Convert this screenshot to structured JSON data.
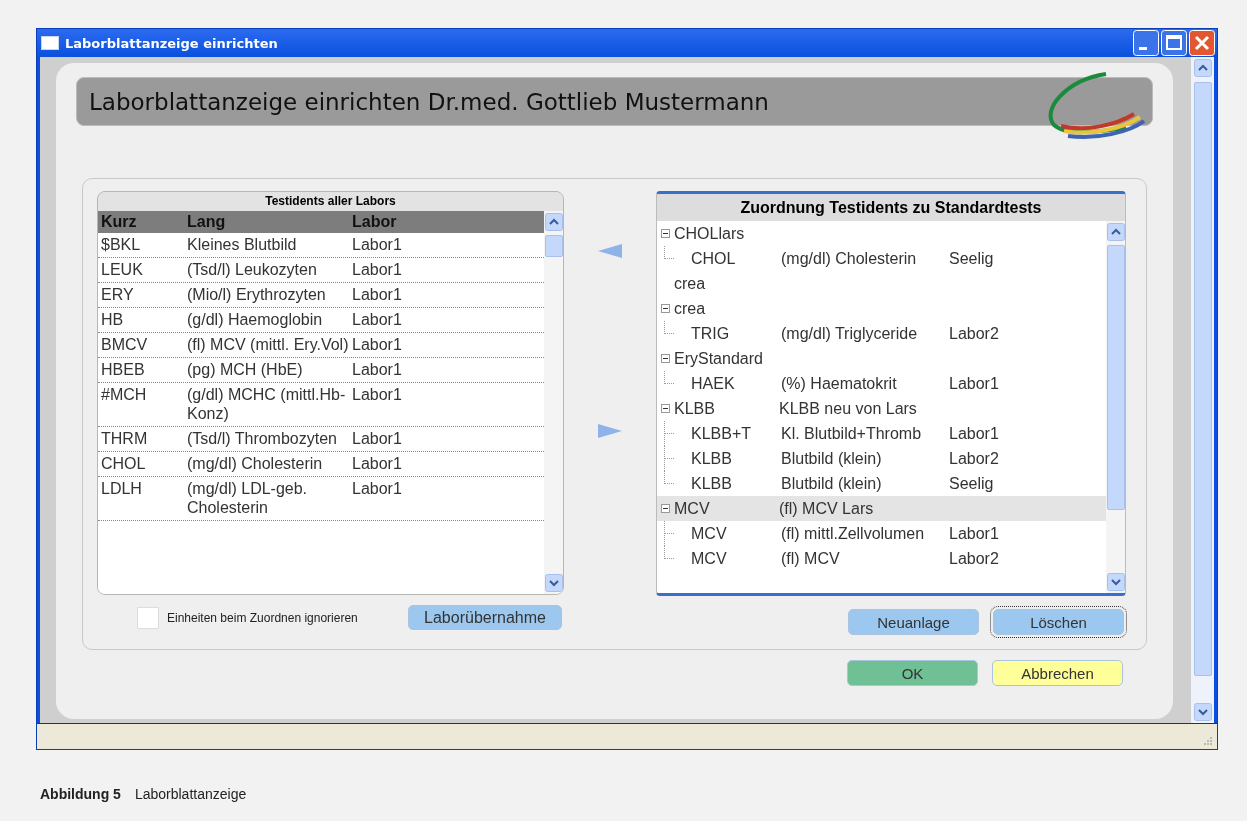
{
  "window": {
    "title": "Laborblattanzeige einrichten"
  },
  "header": {
    "title": "Laborblattanzeige einrichten Dr.med. Gottlieb Mustermann"
  },
  "left_table": {
    "title": "Testidents aller Labors",
    "columns": [
      "Kurz",
      "Lang",
      "Labor"
    ],
    "rows": [
      {
        "cells": [
          "$BKL",
          "Kleines Blutbild",
          "Labor1"
        ]
      },
      {
        "cells": [
          "LEUK",
          "(Tsd/l) Leukozyten",
          "Labor1"
        ]
      },
      {
        "cells": [
          "ERY",
          "(Mio/l) Erythrozyten",
          "Labor1"
        ]
      },
      {
        "cells": [
          "HB",
          "(g/dl) Haemoglobin",
          "Labor1"
        ]
      },
      {
        "cells": [
          "BMCV",
          "(fl) MCV (mittl. Ery.Vol)",
          "Labor1"
        ]
      },
      {
        "cells": [
          "HBEB",
          "(pg) MCH (HbE)",
          "Labor1"
        ]
      },
      {
        "cells": [
          "#MCH",
          "(g/dl) MCHC (mittl.Hb-Konz)",
          "Labor1"
        ]
      },
      {
        "cells": [
          "THRM",
          "(Tsd/l) Thrombozyten",
          "Labor1"
        ]
      },
      {
        "cells": [
          "CHOL",
          "(mg/dl) Cholesterin",
          "Labor1"
        ]
      },
      {
        "cells": [
          "LDLH",
          "(mg/dl) LDL-geb. Cholesterin",
          "Labor1"
        ]
      }
    ]
  },
  "ignore_units": {
    "label": "Einheiten beim Zuordnen ignorieren",
    "checked": false
  },
  "left_button": {
    "label": "Laborübernahme",
    "color": "#9cc8f0",
    "focused": false
  },
  "right_tree": {
    "title": "Zuordnung Testidents zu Standardtests",
    "items": [
      {
        "code": "CHOLlars",
        "expanded": true,
        "selected": false,
        "children": [
          {
            "code": "CHOL",
            "name": "(mg/dl) Cholesterin",
            "labor": "Seelig",
            "selected": false
          }
        ]
      },
      {
        "code": "crea",
        "selected": false
      },
      {
        "code": "crea",
        "expanded": true,
        "selected": false,
        "children": [
          {
            "code": "TRIG",
            "name": "(mg/dl) Triglyceride",
            "labor": "Labor2",
            "selected": false
          }
        ]
      },
      {
        "code": "EryStandard",
        "expanded": true,
        "selected": false,
        "children": [
          {
            "code": "HAEK",
            "name": "(%) Haematokrit",
            "labor": "Labor1",
            "selected": false
          }
        ]
      },
      {
        "code": "KLBB",
        "name": "KLBB neu von Lars",
        "expanded": true,
        "selected": false,
        "children": [
          {
            "code": "KLBB+T",
            "name": "Kl. Blutbild+Thromb",
            "labor": "Labor1",
            "selected": false
          },
          {
            "code": "KLBB",
            "name": "Blutbild (klein)",
            "labor": "Labor2",
            "selected": false
          },
          {
            "code": "KLBB",
            "name": "Blutbild (klein)",
            "labor": "Seelig",
            "selected": false
          }
        ]
      },
      {
        "code": "MCV",
        "name": "(fl) MCV Lars",
        "expanded": true,
        "selected": true,
        "children": [
          {
            "code": "MCV",
            "name": "(fl) mittl.Zellvolumen",
            "labor": "Labor1",
            "selected": false
          },
          {
            "code": "MCV",
            "name": "(fl) MCV",
            "labor": "Labor2",
            "selected": false
          }
        ]
      }
    ]
  },
  "right_buttons": [
    {
      "label": "Neuanlage",
      "color": "#9cc8f0",
      "focused": false
    },
    {
      "label": "Löschen",
      "color": "#9cc8f0",
      "focused": true
    }
  ],
  "dialog_buttons": [
    {
      "label": "OK",
      "color": "#6fc095",
      "focused": false
    },
    {
      "label": "Abbrechen",
      "color": "#ffff99",
      "focused": false
    }
  ],
  "caption": {
    "label": "Abbildung 5",
    "text": "Laborblattanzeige"
  }
}
